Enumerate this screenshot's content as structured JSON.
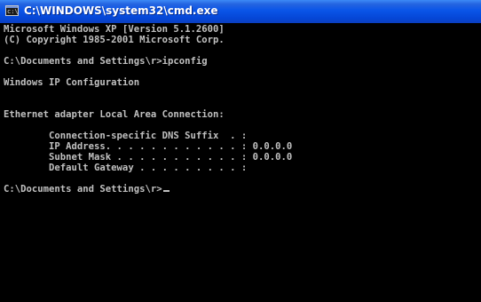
{
  "window": {
    "title": "C:\\WINDOWS\\system32\\cmd.exe",
    "icon_name": "console-app-icon",
    "icon_glyph": "c:\\"
  },
  "console": {
    "lines": [
      "Microsoft Windows XP [Version 5.1.2600]",
      "(C) Copyright 1985-2001 Microsoft Corp.",
      "",
      "C:\\Documents and Settings\\r>ipconfig",
      "",
      "Windows IP Configuration",
      "",
      "",
      "Ethernet adapter Local Area Connection:",
      "",
      "        Connection-specific DNS Suffix  . :",
      "        IP Address. . . . . . . . . . . . : 0.0.0.0",
      "        Subnet Mask . . . . . . . . . . . : 0.0.0.0",
      "        Default Gateway . . . . . . . . . :",
      "",
      "C:\\Documents and Settings\\r>"
    ]
  },
  "colors": {
    "console_background": "#000000",
    "console_text": "#c0c0c0",
    "titlebar": "#0a55e8",
    "title_text": "#ffffff"
  }
}
